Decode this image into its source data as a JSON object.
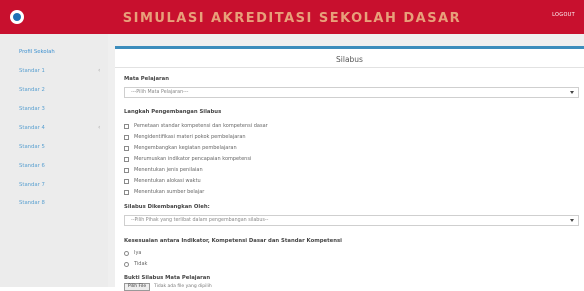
{
  "header": {
    "title": "SIMULASI AKREDITASI SEKOLAH DASAR",
    "logout_label": "LOGOUT"
  },
  "sidebar": {
    "items": [
      {
        "label": "Profil Sekolah",
        "has_chevron": false
      },
      {
        "label": "Standar 1",
        "has_chevron": true
      },
      {
        "label": "Standar 2",
        "has_chevron": false
      },
      {
        "label": "Standar 3",
        "has_chevron": false
      },
      {
        "label": "Standar 4",
        "has_chevron": true
      },
      {
        "label": "Standar 5",
        "has_chevron": false
      },
      {
        "label": "Standar 6",
        "has_chevron": false
      },
      {
        "label": "Standar 7",
        "has_chevron": false
      },
      {
        "label": "Standar 8",
        "has_chevron": false
      }
    ],
    "chevron_glyph": "‹"
  },
  "panel": {
    "title": "Silabus",
    "mata_pelajaran": {
      "label": "Mata Pelajaran",
      "placeholder": "---Pilih Mata Pelajaran---"
    },
    "langkah": {
      "label": "Langkah Pengembangan Silabus",
      "options": [
        "Pemetaan standar kompetensi dan kompetensi dasar",
        "Mengidentifikasi materi pokok pembelajaran",
        "Mengembangkan kegiatan pembelajaran",
        "Merumuskan indikator pencapaian kompetensi",
        "Menentukan jenis penilaian",
        "Menentukan alokasi waktu",
        "Menentukan sumber belajar"
      ]
    },
    "dikembangkan": {
      "label": "Silabus Dikembangkan Oleh:",
      "placeholder": "--Pilih Pihak yang terlibat dalam pengembangan silabus--"
    },
    "kesesuaian": {
      "label": "Kesesuaian antara Indikator, Kompetensi Dasar dan Standar Kompetensi",
      "options": [
        "Iya",
        "Tidak"
      ]
    },
    "bukti": {
      "label": "Bukti Silabus Mata Pelajaran",
      "button_label": "Pilih File",
      "file_text": "Tidak ada file yang dipilih"
    }
  },
  "colors": {
    "header_bg": "#c8102e",
    "title_color": "#e8a07a",
    "accent": "#3c8dbc",
    "sidebar_bg": "#ececec",
    "link": "#5aa0d0"
  }
}
